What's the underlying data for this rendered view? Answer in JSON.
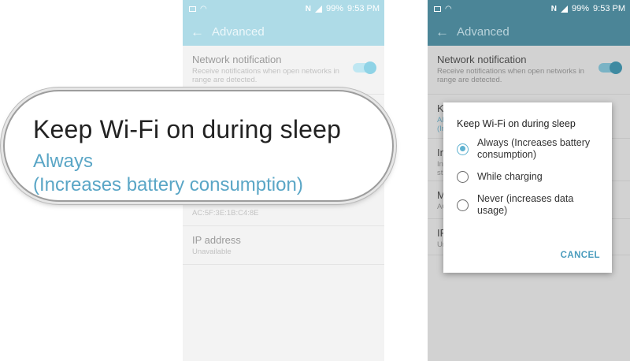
{
  "status_bar": {
    "battery": "99%",
    "time": "9:53 PM",
    "nfc_glyph": "N"
  },
  "app_bar": {
    "back_glyph": "←",
    "title": "Advanced"
  },
  "settings": {
    "network_notification": {
      "title": "Network notification",
      "subtitle": "Receive notifications when open networks in range are detected."
    },
    "partial_items": [
      {
        "title": "K",
        "subtitle": "Al\n(Ir"
      },
      {
        "title": "In",
        "subtitle": "In\nst"
      },
      {
        "title": "M",
        "subtitle": "AC"
      },
      {
        "title": "IP",
        "subtitle": "Ur"
      }
    ],
    "mac_address": {
      "title": "MAC address",
      "subtitle": "AC:5F:3E:1B:C4:8E"
    },
    "ip_address": {
      "title": "IP address",
      "subtitle": "Unavailable"
    }
  },
  "callout": {
    "title": "Keep Wi-Fi on during sleep",
    "line1": "Always",
    "line2": "(Increases battery consumption)"
  },
  "dialog": {
    "title": "Keep Wi-Fi on during sleep",
    "options": [
      {
        "label": "Always (Increases battery consumption)",
        "selected": true
      },
      {
        "label": "While charging",
        "selected": false
      },
      {
        "label": "Never (increases data usage)",
        "selected": false
      }
    ],
    "cancel_label": "CANCEL"
  },
  "colors": {
    "accent": "#5fb2d1",
    "appbar_light": "#aedbe7",
    "appbar_dark": "#4b8597"
  }
}
